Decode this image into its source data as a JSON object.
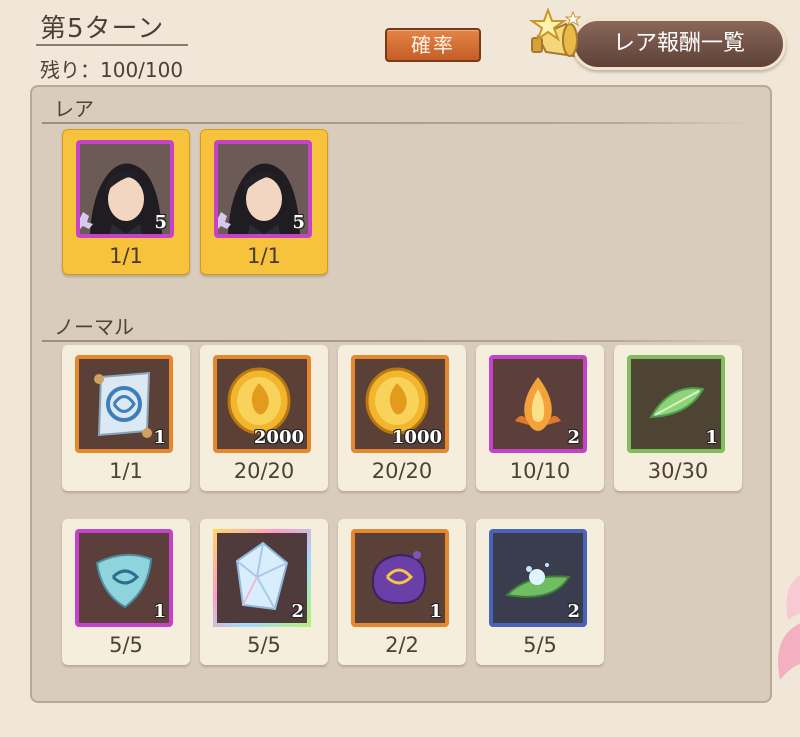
{
  "header": {
    "turn_title": "第5ターン",
    "remaining_label": "残り：",
    "remaining_value": "100/100",
    "probability_button": "確率",
    "rare_rewards_button": "レア報酬一覧"
  },
  "sections": {
    "rare_label": "レア",
    "normal_label": "ノーマル"
  },
  "rare_items": [
    {
      "icon": "character-portrait-icon",
      "quantity": "5",
      "count": "1/1"
    },
    {
      "icon": "character-portrait-icon",
      "quantity": "5",
      "count": "1/1"
    }
  ],
  "normal_items": [
    {
      "icon": "scroll-icon",
      "quantity": "1",
      "count": "1/1"
    },
    {
      "icon": "gold-coin-icon",
      "quantity": "2000",
      "count": "20/20"
    },
    {
      "icon": "gold-coin-icon",
      "quantity": "1000",
      "count": "20/20"
    },
    {
      "icon": "flame-bulb-icon",
      "quantity": "2",
      "count": "10/10"
    },
    {
      "icon": "green-leaf-icon",
      "quantity": "1",
      "count": "30/30"
    },
    {
      "icon": "wind-crystal-icon",
      "quantity": "1",
      "count": "5/5"
    },
    {
      "icon": "prism-gem-icon",
      "quantity": "2",
      "count": "5/5"
    },
    {
      "icon": "purple-slime-icon",
      "quantity": "1",
      "count": "2/2"
    },
    {
      "icon": "sparkle-leaf-icon",
      "quantity": "2",
      "count": "5/5"
    }
  ],
  "colors": {
    "background": "#f1e7d8",
    "panel": "#d9ccbd",
    "rare_card": "#f7c33c",
    "normal_card": "#f6eedd",
    "probability_button": "#d36c33",
    "rare_list_button": "#6f5044"
  }
}
